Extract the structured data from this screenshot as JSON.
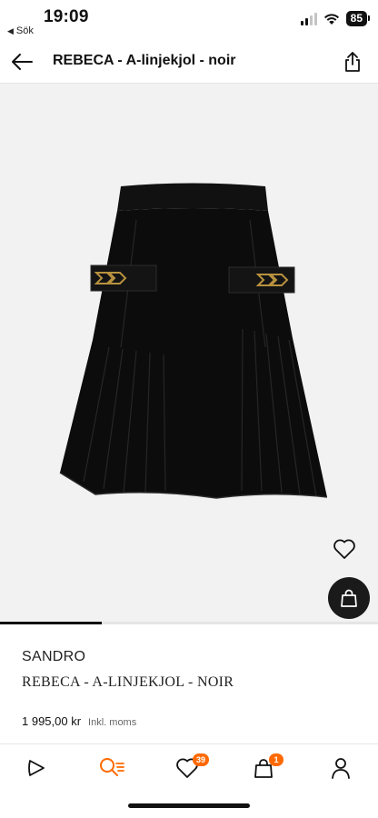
{
  "status_bar": {
    "time": "19:09",
    "back_to_app": "Sök",
    "battery": "85"
  },
  "header": {
    "title": "REBECA - A-linjekjol - noir"
  },
  "product": {
    "image_carousel_progress": 0.27,
    "brand": "SANDRO",
    "name": "REBECA - A-LINJEKJOL - NOIR",
    "price": "1 995,00 kr",
    "tax_note": "Inkl. moms"
  },
  "nav": {
    "wishlist_count": "39",
    "cart_count": "1"
  },
  "colors": {
    "accent": "#ff6900",
    "background": "#ffffff",
    "image_bg": "#f2f2f2",
    "text": "#111111"
  },
  "icons": {
    "status": [
      "signal-icon",
      "wifi-icon",
      "battery-icon"
    ],
    "header": [
      "back-arrow-icon",
      "share-icon"
    ],
    "image": [
      "heart-icon",
      "shopping-bag-icon"
    ],
    "nav": [
      "home-icon",
      "search-icon",
      "heart-icon",
      "bag-icon",
      "profile-icon"
    ]
  }
}
